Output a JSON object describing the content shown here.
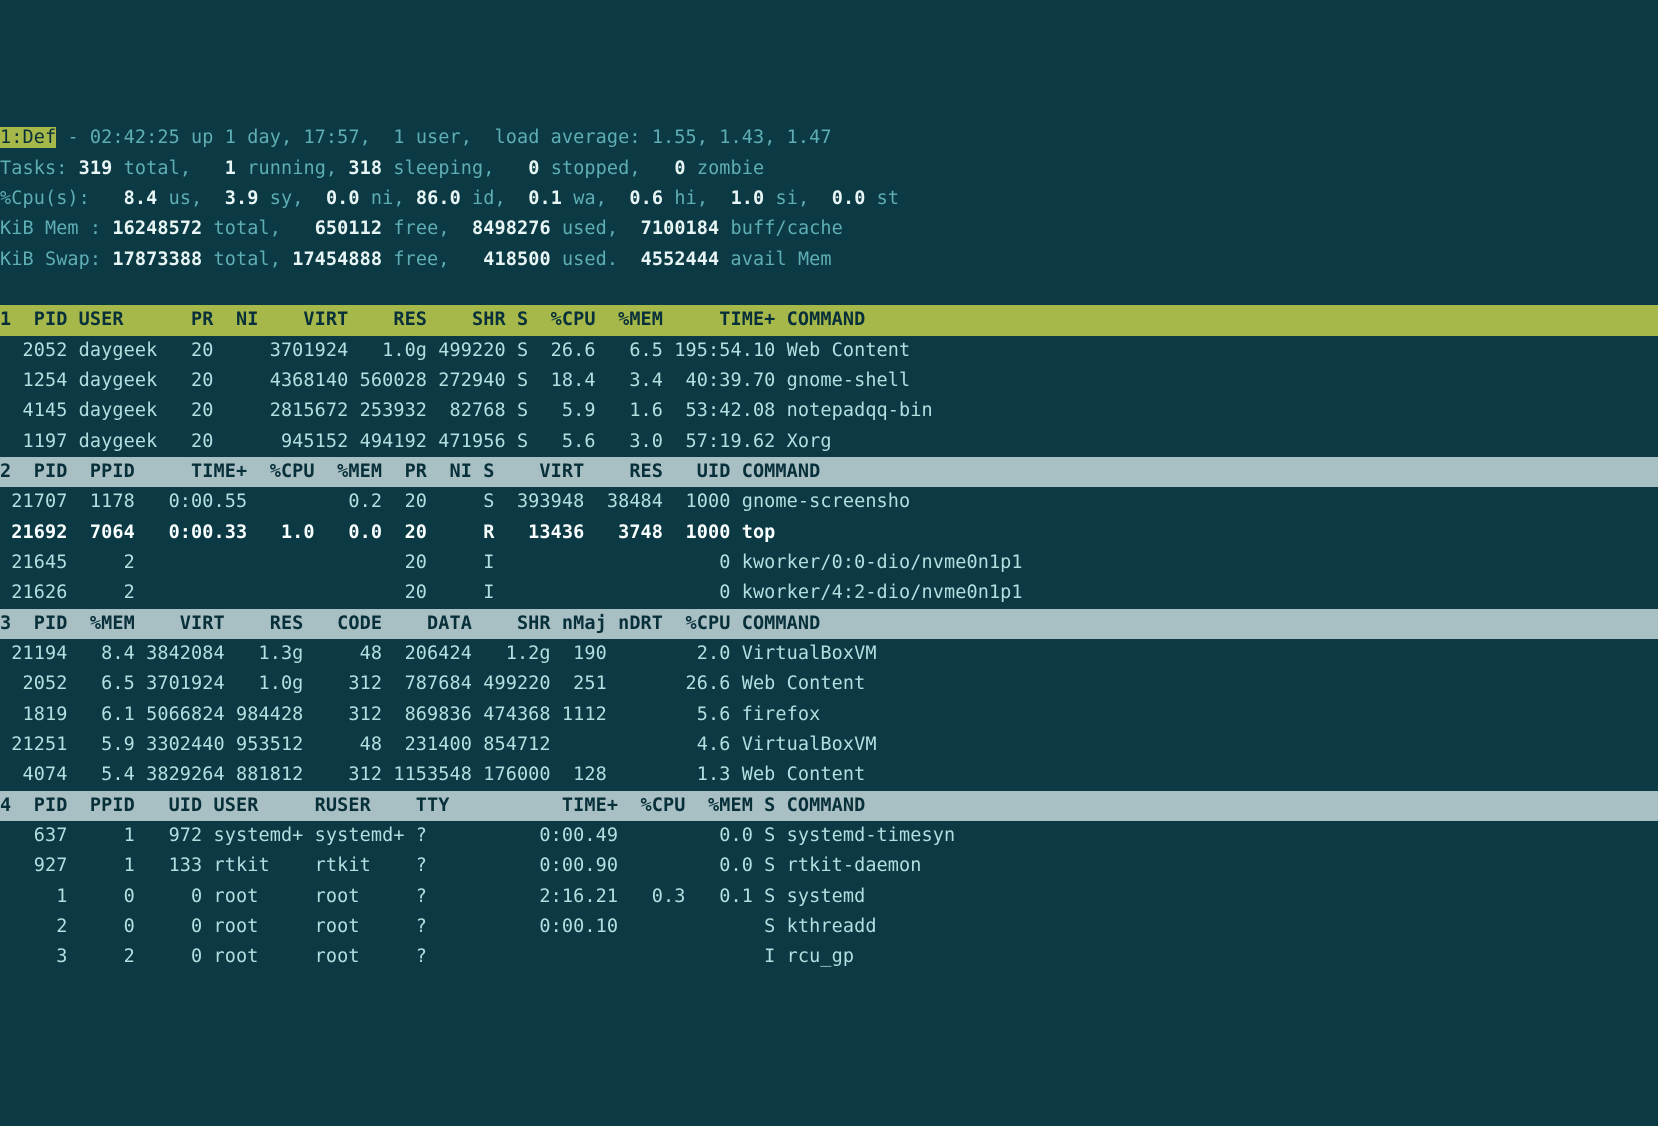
{
  "summary": {
    "tab": "1:Def",
    "top_line": "top - 02:42:25 up 1 day, 17:57,  1 user,  load average: 1.55, 1.43, 1.47",
    "tasks": {
      "label": "Tasks:",
      "total": "319",
      "running": "1",
      "sleeping": "318",
      "stopped": "0",
      "zombie": "0"
    },
    "cpu": {
      "label": "%Cpu(s):",
      "us": "8.4",
      "sy": "3.9",
      "ni": "0.0",
      "id": "86.0",
      "wa": "0.1",
      "hi": "0.6",
      "si": "1.0",
      "st": "0.0"
    },
    "mem": {
      "label": "KiB Mem :",
      "total": "16248572",
      "free": "650112",
      "used": "8498276",
      "buff": "7100184"
    },
    "swap": {
      "label": "KiB Swap:",
      "total": "17873388",
      "free": "17454888",
      "used": "418500",
      "avail": "4552444"
    }
  },
  "pane1": {
    "n": "1",
    "header": "  PID USER      PR  NI    VIRT    RES    SHR S  %CPU  %MEM     TIME+ COMMAND",
    "rows": [
      {
        "pid": "2052",
        "user": "daygeek",
        "pr": "20",
        "ni": "",
        "virt": "3701924",
        "res": "1.0g",
        "shr": "499220",
        "s": "S",
        "cpu": "26.6",
        "mem": "6.5",
        "time": "195:54.10",
        "cmd": "Web Content"
      },
      {
        "pid": "1254",
        "user": "daygeek",
        "pr": "20",
        "ni": "",
        "virt": "4368140",
        "res": "560028",
        "shr": "272940",
        "s": "S",
        "cpu": "18.4",
        "mem": "3.4",
        "time": "40:39.70",
        "cmd": "gnome-shell"
      },
      {
        "pid": "4145",
        "user": "daygeek",
        "pr": "20",
        "ni": "",
        "virt": "2815672",
        "res": "253932",
        "shr": "82768",
        "s": "S",
        "cpu": "5.9",
        "mem": "1.6",
        "time": "53:42.08",
        "cmd": "notepadqq-bin"
      },
      {
        "pid": "1197",
        "user": "daygeek",
        "pr": "20",
        "ni": "",
        "virt": "945152",
        "res": "494192",
        "shr": "471956",
        "s": "S",
        "cpu": "5.6",
        "mem": "3.0",
        "time": "57:19.62",
        "cmd": "Xorg"
      }
    ]
  },
  "pane2": {
    "n": "2",
    "header": "  PID  PPID     TIME+  %CPU  %MEM  PR  NI S    VIRT    RES   UID COMMAND",
    "rows": [
      {
        "pid": "21707",
        "ppid": "1178",
        "time": "0:00.55",
        "cpu": "",
        "mem": "0.2",
        "pr": "20",
        "ni": "",
        "s": "S",
        "virt": "393948",
        "res": "38484",
        "uid": "1000",
        "cmd": "gnome-screensho",
        "bold": false
      },
      {
        "pid": "21692",
        "ppid": "7064",
        "time": "0:00.33",
        "cpu": "1.0",
        "mem": "0.0",
        "pr": "20",
        "ni": "",
        "s": "R",
        "virt": "13436",
        "res": "3748",
        "uid": "1000",
        "cmd": "top",
        "bold": true
      },
      {
        "pid": "21645",
        "ppid": "2",
        "time": "",
        "cpu": "",
        "mem": "",
        "pr": "20",
        "ni": "",
        "s": "I",
        "virt": "",
        "res": "",
        "uid": "0",
        "cmd": "kworker/0:0-dio/nvme0n1p1",
        "bold": false
      },
      {
        "pid": "21626",
        "ppid": "2",
        "time": "",
        "cpu": "",
        "mem": "",
        "pr": "20",
        "ni": "",
        "s": "I",
        "virt": "",
        "res": "",
        "uid": "0",
        "cmd": "kworker/4:2-dio/nvme0n1p1",
        "bold": false
      }
    ]
  },
  "pane3": {
    "n": "3",
    "header": "  PID  %MEM    VIRT    RES   CODE    DATA    SHR nMaj nDRT  %CPU COMMAND",
    "rows": [
      {
        "pid": "21194",
        "mem": "8.4",
        "virt": "3842084",
        "res": "1.3g",
        "code": "48",
        "data": "206424",
        "shr": "1.2g",
        "nmaj": "190",
        "ndrt": "",
        "cpu": "2.0",
        "cmd": "VirtualBoxVM"
      },
      {
        "pid": "2052",
        "mem": "6.5",
        "virt": "3701924",
        "res": "1.0g",
        "code": "312",
        "data": "787684",
        "shr": "499220",
        "nmaj": "251",
        "ndrt": "",
        "cpu": "26.6",
        "cmd": "Web Content"
      },
      {
        "pid": "1819",
        "mem": "6.1",
        "virt": "5066824",
        "res": "984428",
        "code": "312",
        "data": "869836",
        "shr": "474368",
        "nmaj": "1112",
        "ndrt": "",
        "cpu": "5.6",
        "cmd": "firefox"
      },
      {
        "pid": "21251",
        "mem": "5.9",
        "virt": "3302440",
        "res": "953512",
        "code": "48",
        "data": "231400",
        "shr": "854712",
        "nmaj": "",
        "ndrt": "",
        "cpu": "4.6",
        "cmd": "VirtualBoxVM"
      },
      {
        "pid": "4074",
        "mem": "5.4",
        "virt": "3829264",
        "res": "881812",
        "code": "312",
        "data": "1153548",
        "shr": "176000",
        "nmaj": "128",
        "ndrt": "",
        "cpu": "1.3",
        "cmd": "Web Content"
      }
    ]
  },
  "pane4": {
    "n": "4",
    "header": "  PID  PPID   UID USER     RUSER    TTY          TIME+  %CPU  %MEM S COMMAND",
    "rows": [
      {
        "pid": "637",
        "ppid": "1",
        "uid": "972",
        "user": "systemd+",
        "ruser": "systemd+",
        "tty": "?",
        "time": "0:00.49",
        "cpu": "",
        "mem": "0.0",
        "s": "S",
        "cmd": "systemd-timesyn"
      },
      {
        "pid": "927",
        "ppid": "1",
        "uid": "133",
        "user": "rtkit",
        "ruser": "rtkit",
        "tty": "?",
        "time": "0:00.90",
        "cpu": "",
        "mem": "0.0",
        "s": "S",
        "cmd": "rtkit-daemon"
      },
      {
        "pid": "1",
        "ppid": "0",
        "uid": "0",
        "user": "root",
        "ruser": "root",
        "tty": "?",
        "time": "2:16.21",
        "cpu": "0.3",
        "mem": "0.1",
        "s": "S",
        "cmd": "systemd"
      },
      {
        "pid": "2",
        "ppid": "0",
        "uid": "0",
        "user": "root",
        "ruser": "root",
        "tty": "?",
        "time": "0:00.10",
        "cpu": "",
        "mem": "",
        "s": "S",
        "cmd": "kthreadd"
      },
      {
        "pid": "3",
        "ppid": "2",
        "uid": "0",
        "user": "root",
        "ruser": "root",
        "tty": "?",
        "time": "",
        "cpu": "",
        "mem": "",
        "s": "I",
        "cmd": "rcu_gp"
      }
    ]
  }
}
